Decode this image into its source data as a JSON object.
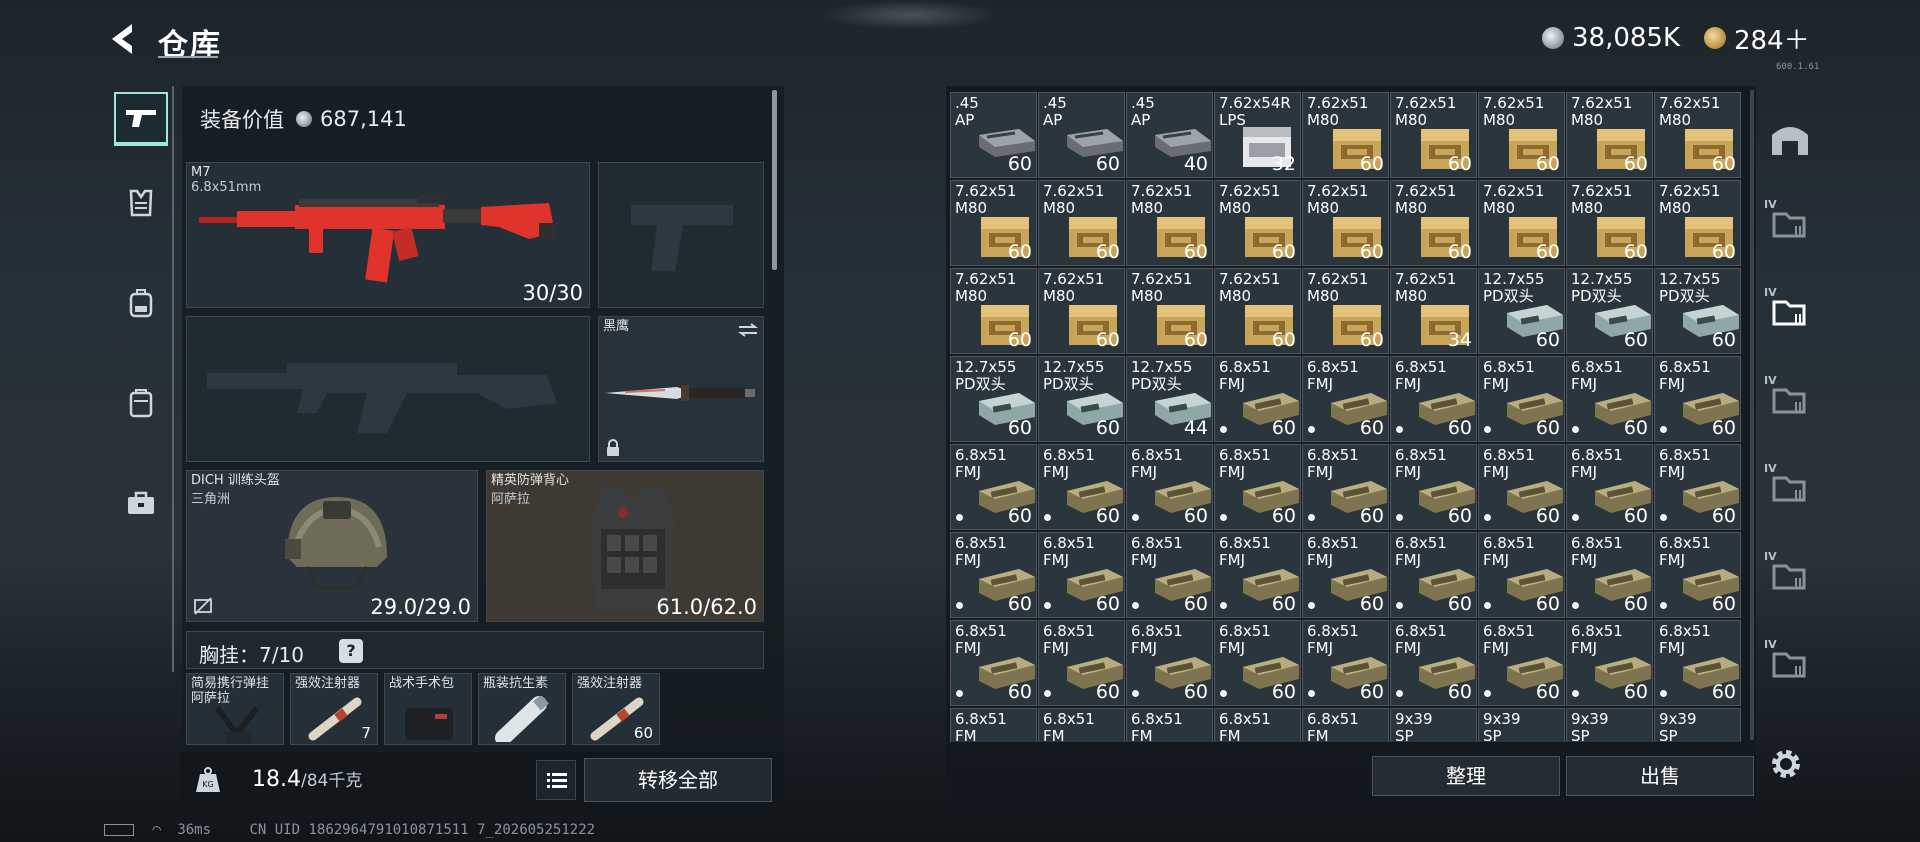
{
  "header": {
    "title": "仓库",
    "currency1": "38,085K",
    "currency2": "284＋",
    "version": "600.1.61"
  },
  "loadout": {
    "equip_value_label": "装备价值",
    "equip_value": "687,141",
    "primary": {
      "name": "M7",
      "caliber": "6.8x51mm",
      "ammo": "30/30"
    },
    "melee": {
      "name": "黑鹰"
    },
    "helmet": {
      "name": "DICH 训练头盔",
      "sub": "三角洲",
      "durability": "29.0/29.0"
    },
    "armor": {
      "name": "精英防弹背心",
      "sub": "阿萨拉",
      "durability": "61.0/62.0"
    },
    "rig": {
      "label": "胸挂：",
      "capacity": "7/10",
      "help": "?"
    },
    "rig_items": [
      {
        "name": "简易携行弹挂\n阿萨拉",
        "qty": ""
      },
      {
        "name": "强效注射器",
        "qty": "7"
      },
      {
        "name": "战术手术包",
        "qty": ""
      },
      {
        "name": "瓶装抗生素",
        "qty": ""
      },
      {
        "name": "强效注射器",
        "qty": "60"
      }
    ],
    "weight": "18.4",
    "weight_max": "/84千克",
    "transfer_all": "转移全部"
  },
  "stash": {
    "sort_button": "整理",
    "sell_button": "出售",
    "items": [
      {
        "name": ".45\nAP",
        "qty": "60",
        "kind": "ap45",
        "dot": false
      },
      {
        "name": ".45\nAP",
        "qty": "60",
        "kind": "ap45",
        "dot": false
      },
      {
        "name": ".45\nAP",
        "qty": "40",
        "kind": "ap45",
        "dot": false
      },
      {
        "name": "7.62x54R\nLPS",
        "qty": "32",
        "kind": "lps",
        "dot": false
      },
      {
        "name": "7.62x51\nM80",
        "qty": "60",
        "kind": "m80",
        "dot": false
      },
      {
        "name": "7.62x51\nM80",
        "qty": "60",
        "kind": "m80",
        "dot": false
      },
      {
        "name": "7.62x51\nM80",
        "qty": "60",
        "kind": "m80",
        "dot": false
      },
      {
        "name": "7.62x51\nM80",
        "qty": "60",
        "kind": "m80",
        "dot": false
      },
      {
        "name": "7.62x51\nM80",
        "qty": "60",
        "kind": "m80",
        "dot": false
      },
      {
        "name": "7.62x51\nM80",
        "qty": "60",
        "kind": "m80",
        "dot": false
      },
      {
        "name": "7.62x51\nM80",
        "qty": "60",
        "kind": "m80",
        "dot": false
      },
      {
        "name": "7.62x51\nM80",
        "qty": "60",
        "kind": "m80",
        "dot": false
      },
      {
        "name": "7.62x51\nM80",
        "qty": "60",
        "kind": "m80",
        "dot": false
      },
      {
        "name": "7.62x51\nM80",
        "qty": "60",
        "kind": "m80",
        "dot": false
      },
      {
        "name": "7.62x51\nM80",
        "qty": "60",
        "kind": "m80",
        "dot": false
      },
      {
        "name": "7.62x51\nM80",
        "qty": "60",
        "kind": "m80",
        "dot": false
      },
      {
        "name": "7.62x51\nM80",
        "qty": "60",
        "kind": "m80",
        "dot": false
      },
      {
        "name": "7.62x51\nM80",
        "qty": "60",
        "kind": "m80",
        "dot": false
      },
      {
        "name": "7.62x51\nM80",
        "qty": "60",
        "kind": "m80",
        "dot": false
      },
      {
        "name": "7.62x51\nM80",
        "qty": "60",
        "kind": "m80",
        "dot": false
      },
      {
        "name": "7.62x51\nM80",
        "qty": "60",
        "kind": "m80",
        "dot": false
      },
      {
        "name": "7.62x51\nM80",
        "qty": "60",
        "kind": "m80",
        "dot": false
      },
      {
        "name": "7.62x51\nM80",
        "qty": "60",
        "kind": "m80",
        "dot": false
      },
      {
        "name": "7.62x51\nM80",
        "qty": "34",
        "kind": "m80",
        "dot": false
      },
      {
        "name": "12.7x55\nPD双头",
        "qty": "60",
        "kind": "pd",
        "dot": false
      },
      {
        "name": "12.7x55\nPD双头",
        "qty": "60",
        "kind": "pd",
        "dot": false
      },
      {
        "name": "12.7x55\nPD双头",
        "qty": "60",
        "kind": "pd",
        "dot": false
      },
      {
        "name": "12.7x55\nPD双头",
        "qty": "60",
        "kind": "pd",
        "dot": false
      },
      {
        "name": "12.7x55\nPD双头",
        "qty": "60",
        "kind": "pd",
        "dot": false
      },
      {
        "name": "12.7x55\nPD双头",
        "qty": "44",
        "kind": "pd",
        "dot": false
      },
      {
        "name": "6.8x51\nFMJ",
        "qty": "60",
        "kind": "fmj",
        "dot": true
      },
      {
        "name": "6.8x51\nFMJ",
        "qty": "60",
        "kind": "fmj",
        "dot": true
      },
      {
        "name": "6.8x51\nFMJ",
        "qty": "60",
        "kind": "fmj",
        "dot": true
      },
      {
        "name": "6.8x51\nFMJ",
        "qty": "60",
        "kind": "fmj",
        "dot": true
      },
      {
        "name": "6.8x51\nFMJ",
        "qty": "60",
        "kind": "fmj",
        "dot": true
      },
      {
        "name": "6.8x51\nFMJ",
        "qty": "60",
        "kind": "fmj",
        "dot": true
      },
      {
        "name": "6.8x51\nFMJ",
        "qty": "60",
        "kind": "fmj",
        "dot": true
      },
      {
        "name": "6.8x51\nFMJ",
        "qty": "60",
        "kind": "fmj",
        "dot": true
      },
      {
        "name": "6.8x51\nFMJ",
        "qty": "60",
        "kind": "fmj",
        "dot": true
      },
      {
        "name": "6.8x51\nFMJ",
        "qty": "60",
        "kind": "fmj",
        "dot": true
      },
      {
        "name": "6.8x51\nFMJ",
        "qty": "60",
        "kind": "fmj",
        "dot": true
      },
      {
        "name": "6.8x51\nFMJ",
        "qty": "60",
        "kind": "fmj",
        "dot": true
      },
      {
        "name": "6.8x51\nFMJ",
        "qty": "60",
        "kind": "fmj",
        "dot": true
      },
      {
        "name": "6.8x51\nFMJ",
        "qty": "60",
        "kind": "fmj",
        "dot": true
      },
      {
        "name": "6.8x51\nFMJ",
        "qty": "60",
        "kind": "fmj",
        "dot": true
      },
      {
        "name": "6.8x51\nFMJ",
        "qty": "60",
        "kind": "fmj",
        "dot": true
      },
      {
        "name": "6.8x51\nFMJ",
        "qty": "60",
        "kind": "fmj",
        "dot": true
      },
      {
        "name": "6.8x51\nFMJ",
        "qty": "60",
        "kind": "fmj",
        "dot": true
      },
      {
        "name": "6.8x51\nFMJ",
        "qty": "60",
        "kind": "fmj",
        "dot": true
      },
      {
        "name": "6.8x51\nFMJ",
        "qty": "60",
        "kind": "fmj",
        "dot": true
      },
      {
        "name": "6.8x51\nFMJ",
        "qty": "60",
        "kind": "fmj",
        "dot": true
      },
      {
        "name": "6.8x51\nFMJ",
        "qty": "60",
        "kind": "fmj",
        "dot": true
      },
      {
        "name": "6.8x51\nFMJ",
        "qty": "60",
        "kind": "fmj",
        "dot": true
      },
      {
        "name": "6.8x51\nFMJ",
        "qty": "60",
        "kind": "fmj",
        "dot": true
      },
      {
        "name": "6.8x51\nFMJ",
        "qty": "60",
        "kind": "fmj",
        "dot": true
      },
      {
        "name": "6.8x51\nFMJ",
        "qty": "60",
        "kind": "fmj",
        "dot": true
      },
      {
        "name": "6.8x51\nFMJ",
        "qty": "60",
        "kind": "fmj",
        "dot": true
      },
      {
        "name": "6.8x51\nFMJ",
        "qty": "60",
        "kind": "fmj",
        "dot": true
      },
      {
        "name": "6.8x51\nFMJ",
        "qty": "60",
        "kind": "fmj",
        "dot": true
      },
      {
        "name": "6.8x51\nFMJ",
        "qty": "60",
        "kind": "fmj",
        "dot": true
      },
      {
        "name": "6.8x51\nFMJ",
        "qty": "60",
        "kind": "fmj",
        "dot": true
      },
      {
        "name": "6.8x51\nFMJ",
        "qty": "60",
        "kind": "fmj",
        "dot": true
      },
      {
        "name": "6.8x51\nFMJ",
        "qty": "60",
        "kind": "fmj",
        "dot": true
      },
      {
        "name": "6.8x51\nFM",
        "qty": "",
        "kind": "fmj",
        "dot": false
      },
      {
        "name": "6.8x51\nFM",
        "qty": "",
        "kind": "fmj",
        "dot": false
      },
      {
        "name": "6.8x51\nFM",
        "qty": "",
        "kind": "fmj",
        "dot": false
      },
      {
        "name": "6.8x51\nFM",
        "qty": "",
        "kind": "fmj",
        "dot": false
      },
      {
        "name": "6.8x51\nFM",
        "qty": "",
        "kind": "fmj",
        "dot": false
      },
      {
        "name": "9x39\nSP",
        "qty": "",
        "kind": "fmj",
        "dot": false
      },
      {
        "name": "9x39\nSP",
        "qty": "",
        "kind": "fmj",
        "dot": false
      },
      {
        "name": "9x39\nSP",
        "qty": "",
        "kind": "fmj",
        "dot": false
      },
      {
        "name": "9x39\nSP",
        "qty": "",
        "kind": "fmj",
        "dot": false
      }
    ]
  },
  "right_nav": {
    "tiers": [
      "",
      "IV",
      "IV",
      "IV",
      "IV",
      "IV",
      "IV"
    ]
  },
  "status_bar": {
    "ping": "36ms",
    "uid": "CN UID 1862964791010871511 7_202605251222"
  },
  "colors": {
    "accent": "#9fe8d6",
    "weapon_red": "#e0332b",
    "armor_bg": "#3e3933"
  }
}
